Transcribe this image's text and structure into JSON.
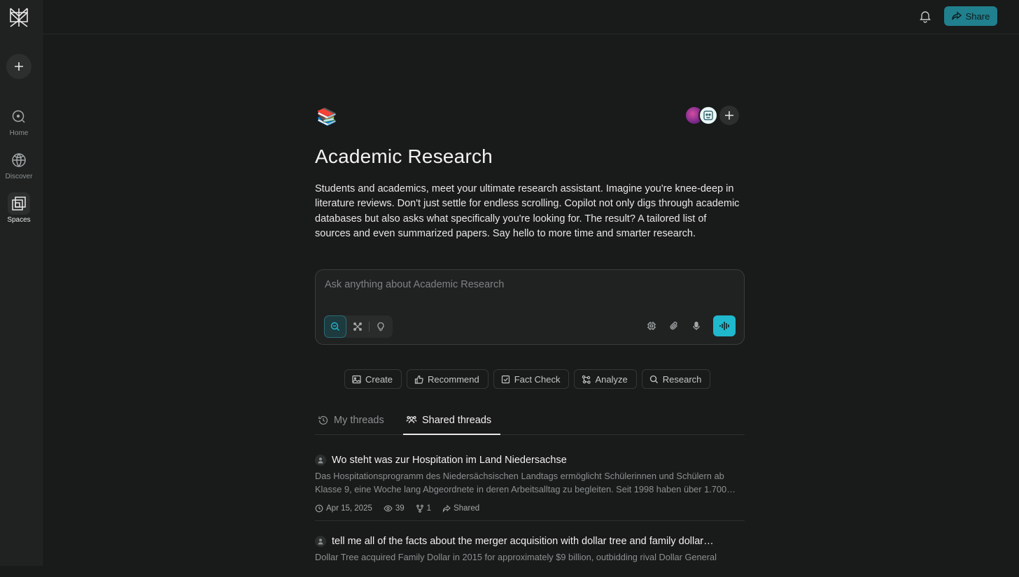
{
  "colors": {
    "accent": "#20b8cd",
    "share_bg": "#20808d",
    "background": "#191a1a",
    "sidebar_bg": "#202222"
  },
  "sidebar": {
    "items": [
      {
        "label": "Home",
        "icon": "home-search-icon"
      },
      {
        "label": "Discover",
        "icon": "globe-icon"
      },
      {
        "label": "Spaces",
        "icon": "spaces-icon",
        "active": true
      }
    ]
  },
  "topbar": {
    "share_label": "Share"
  },
  "space": {
    "emoji": "📚",
    "title": "Academic Research",
    "description": "Students and academics, meet your ultimate research assistant. Imagine you're knee-deep in literature reviews. Don't just settle for endless scrolling. Copilot not only digs through academic databases but also asks what specifically you're looking for. The result? A tailored list of sources and even summarized papers. Say hello to more time and smarter research."
  },
  "ask": {
    "placeholder": "Ask anything about Academic Research"
  },
  "chips": [
    {
      "label": "Create",
      "icon": "image-icon"
    },
    {
      "label": "Recommend",
      "icon": "thumbs-up-icon"
    },
    {
      "label": "Fact Check",
      "icon": "check-square-icon"
    },
    {
      "label": "Analyze",
      "icon": "analyze-icon"
    },
    {
      "label": "Research",
      "icon": "search-icon"
    }
  ],
  "tabs": [
    {
      "label": "My threads",
      "icon": "history-icon"
    },
    {
      "label": "Shared threads",
      "icon": "users-icon",
      "active": true
    }
  ],
  "threads": [
    {
      "title": "Wo steht was zur Hospitation im Land Niedersachse",
      "excerpt": "Das Hospitationsprogramm des Niedersächsischen Landtags ermöglicht Schülerinnen und Schülern ab Klasse 9, eine Woche lang Abgeordnete in deren Arbeitsalltag zu begleiten. Seit 1998 haben über 1.700…",
      "date": "Apr 15, 2025",
      "views": "39",
      "forks": "1",
      "status": "Shared"
    },
    {
      "title": "tell me all of the facts about the merger acquisition with dollar tree and family dollar…",
      "excerpt": "Dollar Tree acquired Family Dollar in 2015 for approximately $9 billion, outbidding rival Dollar General"
    }
  ]
}
